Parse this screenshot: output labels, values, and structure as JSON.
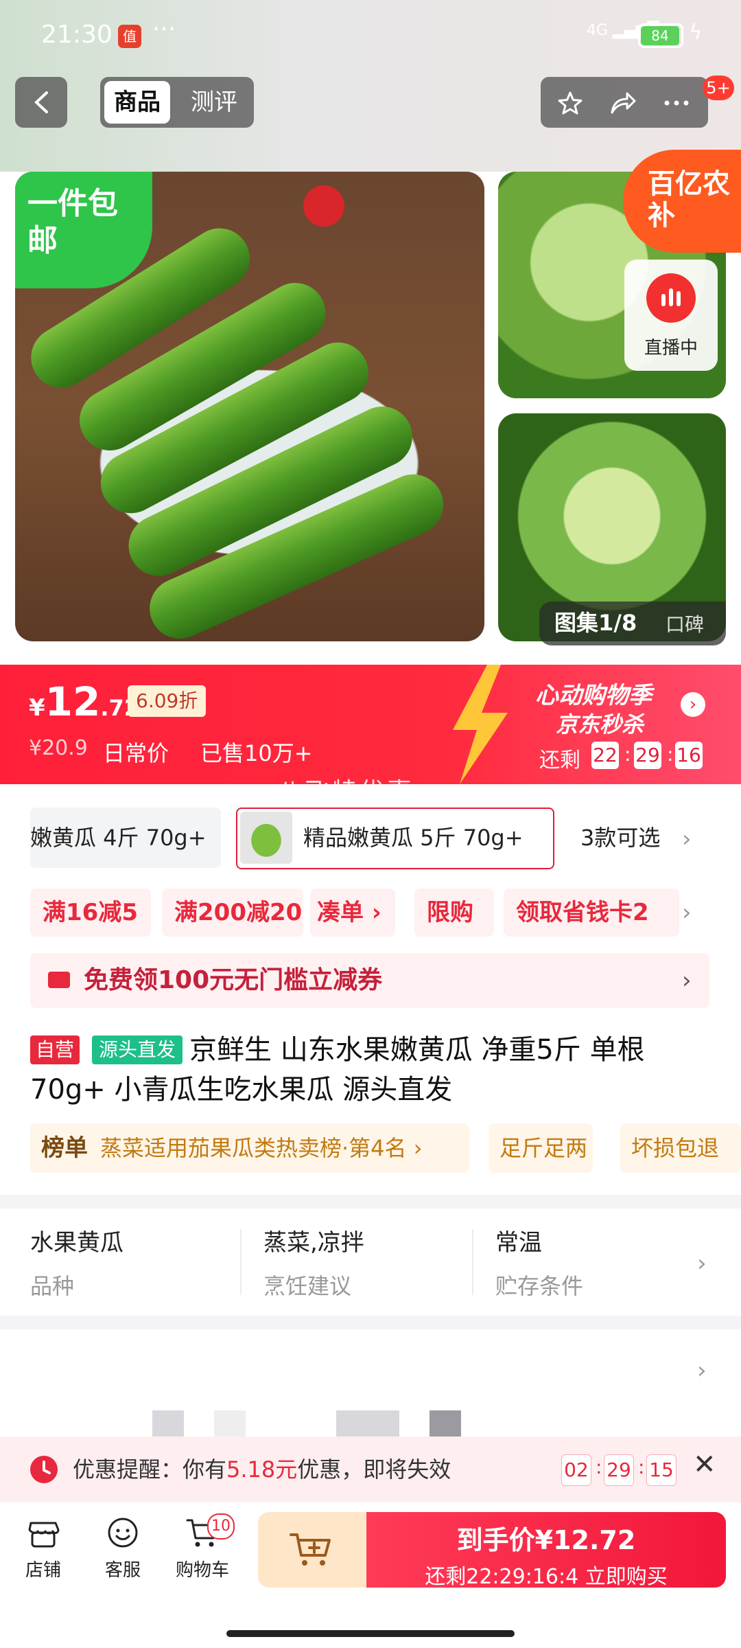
{
  "status_bar": {
    "time": "21:30",
    "app_icon_text": "值",
    "more": "···",
    "network": "4G",
    "battery": "84"
  },
  "header": {
    "tabs": [
      {
        "label": "商品",
        "active": true
      },
      {
        "label": "测评",
        "active": false
      }
    ],
    "message_badge": "5+"
  },
  "gallery": {
    "free_shipping_tag": "一件包邮",
    "subsidy_badge": "百亿农补",
    "live_label": "直播中",
    "album_count": "图集1/8",
    "reviews_label": "口碑"
  },
  "price": {
    "currency": "¥",
    "integer": "12",
    "decimal": ".72",
    "discount": "6.09折",
    "original_price": "¥20.9",
    "original_label": "日常价",
    "sold": "已售10万+",
    "flash_title": "心动购物季",
    "flash_subtitle": "京东秒杀",
    "flash_arrow": "›",
    "remain_label": "还剩",
    "countdown": [
      "22",
      "29",
      "16"
    ],
    "watermark": "八飞特优惠"
  },
  "variants": {
    "items": [
      "嫩黄瓜 4斤 70g+",
      "精品嫩黄瓜 5斤 70g+"
    ],
    "count_label": "3款可选",
    "chevron": "›"
  },
  "coupons": {
    "items": [
      "满16减5",
      "满200减20",
      "凑单 ›",
      "限购",
      "领取省钱卡2"
    ],
    "chevron": "›"
  },
  "voucher": {
    "text": "免费领100元无门槛立减券",
    "chevron": "›"
  },
  "product": {
    "badge_self": "自营",
    "badge_source": "源头直发",
    "title": "京鲜生 山东水果嫩黄瓜 净重5斤 单根70g+ 小青瓜生吃水果瓜 源头直发",
    "rank_label": "榜单",
    "rank_text": "蒸菜适用茄果瓜类热卖榜·第4名 ›",
    "service_tags": [
      "足斤足两",
      "坏损包退"
    ]
  },
  "attributes": {
    "items": [
      {
        "value": "水果黄瓜",
        "key": "品种"
      },
      {
        "value": "蒸菜,凉拌",
        "key": "烹饪建议"
      },
      {
        "value": "常温",
        "key": "贮存条件"
      }
    ],
    "chevron": "›"
  },
  "more_section": {
    "chevron": "›"
  },
  "reminder": {
    "prefix": "优惠提醒：你有",
    "amount": "5.18元",
    "suffix": "优惠，即将失效",
    "countdown": [
      "02",
      "29",
      "15"
    ],
    "close": "✕"
  },
  "bottom_nav": {
    "items": [
      {
        "label": "店铺"
      },
      {
        "label": "客服"
      },
      {
        "label": "购物车"
      }
    ],
    "cart_badge": "10",
    "buy_price": "到手价¥12.72",
    "buy_countdown": "还剩22:29:16:4",
    "buy_action": "立即购买"
  },
  "colors": {
    "primary_red": "#f2173a",
    "free_ship_green": "#2fc44a",
    "subsidy_orange": "#ff5a1f"
  }
}
